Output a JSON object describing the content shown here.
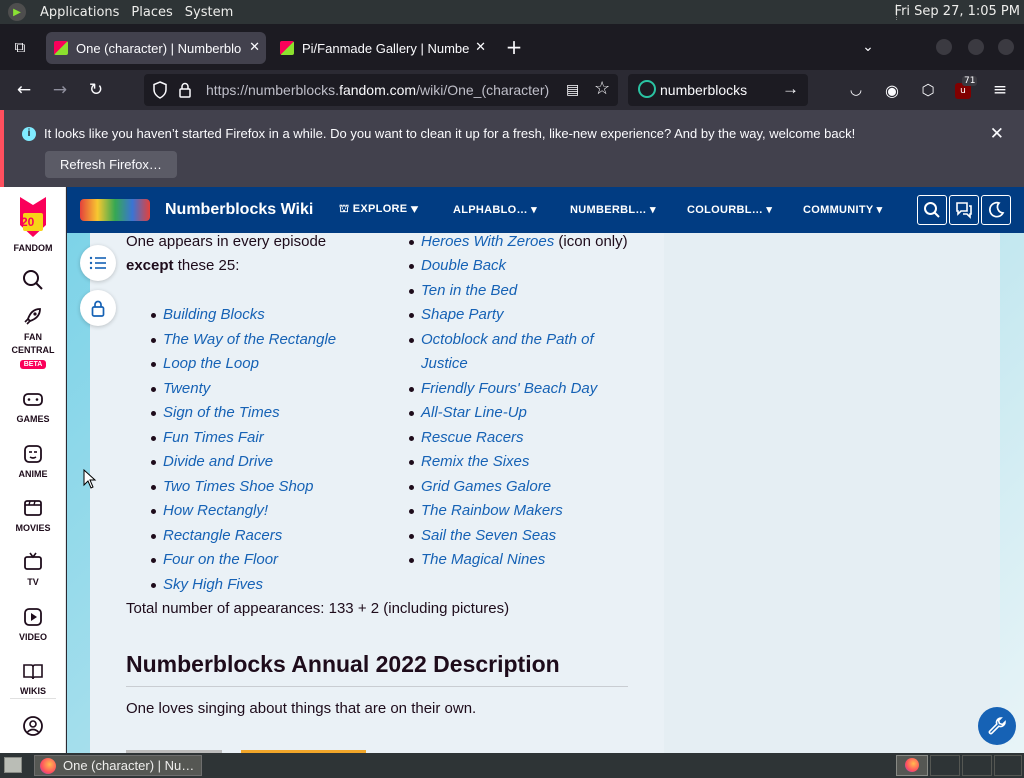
{
  "top_panel": {
    "menus": [
      "Applications",
      "Places",
      "System"
    ],
    "clock": "Fri Sep 27,  1:05 PM"
  },
  "tabs": [
    {
      "title": "One (character) | Numberblo",
      "active": true
    },
    {
      "title": "Pi/Fanmade Gallery | Numbe",
      "active": false
    }
  ],
  "navbar": {
    "url_prefix": "https://numberblocks.",
    "url_domain": "fandom.com",
    "url_path": "/wiki/One_(character)",
    "search_value": "numberblocks",
    "extension_badge": "71"
  },
  "notification": {
    "message": "It looks like you haven’t started Firefox in a while. Do you want to clean it up for a fresh, like-new experience? And by the way, welcome back!",
    "button": "Refresh Firefox…"
  },
  "rail": {
    "logo_number": "20",
    "fandom": "FANDOM",
    "fan_central": "FAN\nCENTRAL",
    "beta": "BETA",
    "games": "GAMES",
    "anime": "ANIME",
    "movies": "MOVIES",
    "tv": "TV",
    "video": "VIDEO",
    "wikis": "WIKIS"
  },
  "wiki_header": {
    "name": "Numberblocks Wiki",
    "nav": [
      "EXPLORE",
      "ALPHABLO…",
      "NUMBERBL…",
      "COLOURBL…",
      "COMMUNITY"
    ]
  },
  "article": {
    "intro_line1": "One appears in every episode",
    "intro_bold": "except",
    "intro_rest": " these 25:",
    "left_list": [
      "Building Blocks",
      "The Way of the Rectangle",
      "Loop the Loop",
      "Twenty",
      "Sign of the Times",
      "Fun Times Fair",
      "Divide and Drive",
      "Two Times Shoe Shop",
      "How Rectangly!",
      "Rectangle Racers",
      "Four on the Floor",
      "Sky High Fives"
    ],
    "right_first": "Heroes With Zeroes",
    "right_first_note": " (icon only)",
    "right_list": [
      "Double Back",
      "Ten in the Bed",
      "Shape Party",
      "Octoblock and the Path of",
      "Justice",
      "Friendly Fours' Beach Day",
      "All-Star Line-Up",
      "Rescue Racers",
      "Remix the Sixes",
      "Grid Games Galore",
      "The Rainbow Makers",
      "Sail the Seven Seas",
      "The Magical Nines"
    ],
    "total": "Total number of appearances: 133 + 2 (including pictures)",
    "heading": "Numberblocks Annual 2022 Description",
    "description": "One loves singing about things that are on their own."
  },
  "taskbar": {
    "window_title": "One (character) | Nu…"
  },
  "colors": {
    "fandom_pink": "#fa005a",
    "wiki_header": "#013c82",
    "link": "#1662b5"
  }
}
